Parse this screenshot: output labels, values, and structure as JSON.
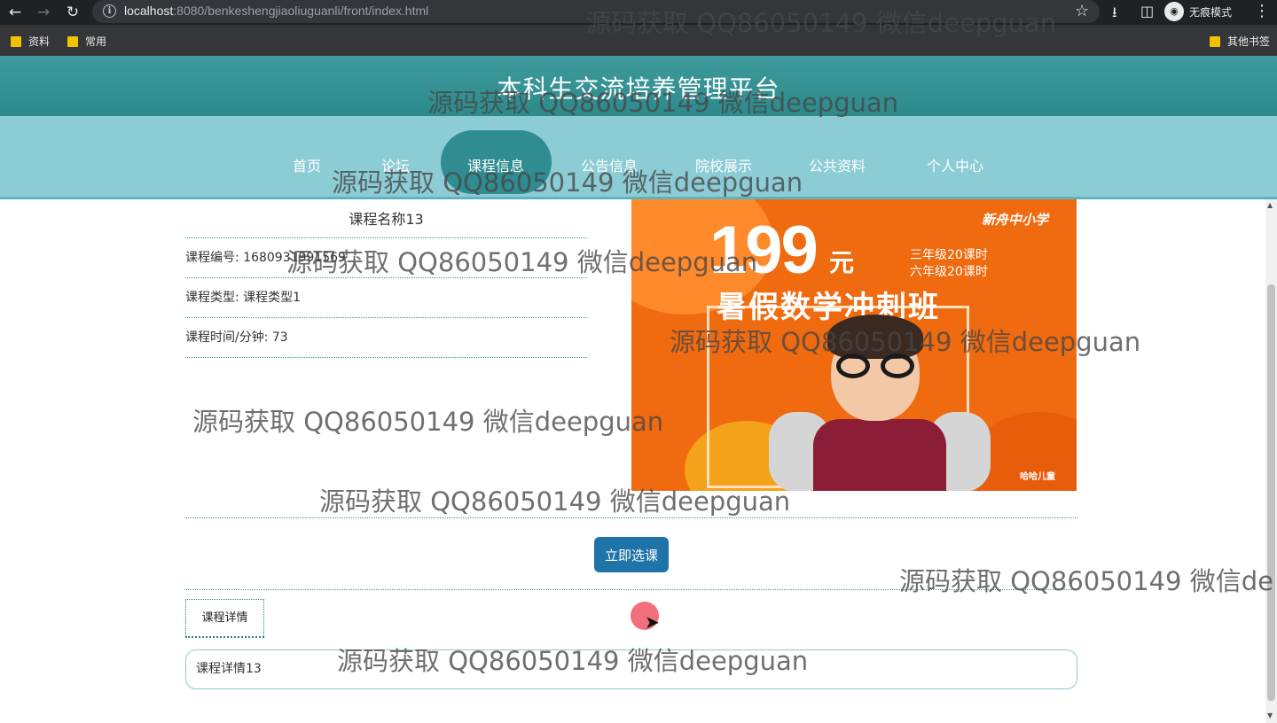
{
  "browser": {
    "url_host": "localhost",
    "url_rest": ":8080/benkeshengjiaoliuguanli/front/index.html",
    "incognito_label": "无痕模式",
    "bookmarks": [
      "资料",
      "常用"
    ],
    "other_bookmarks": "其他书签"
  },
  "site": {
    "title": "本科生交流培养管理平台",
    "nav": [
      "首页",
      "论坛",
      "课程信息",
      "公告信息",
      "院校展示",
      "公共资料",
      "个人中心"
    ],
    "active_nav": "课程信息"
  },
  "course": {
    "name": "课程名称13",
    "fields": [
      {
        "label": "课程编号:",
        "value": "1680931991569"
      },
      {
        "label": "课程类型:",
        "value": "课程类型1"
      },
      {
        "label": "课程时间/分钟:",
        "value": "73"
      }
    ],
    "select_button": "立即选课",
    "detail_tab": "课程详情",
    "detail_content": "课程详情13"
  },
  "banner": {
    "price": "199",
    "unit": "元",
    "title": "暑假数学冲刺班",
    "notes": [
      "三年级20课时",
      "六年级20课时"
    ],
    "logo": "新舟中小学",
    "brand": "哈哈儿童"
  },
  "watermark": "源码获取 QQ86050149 微信deepguan",
  "watermark_cut": "源码获取 QQ86050149 微信de"
}
